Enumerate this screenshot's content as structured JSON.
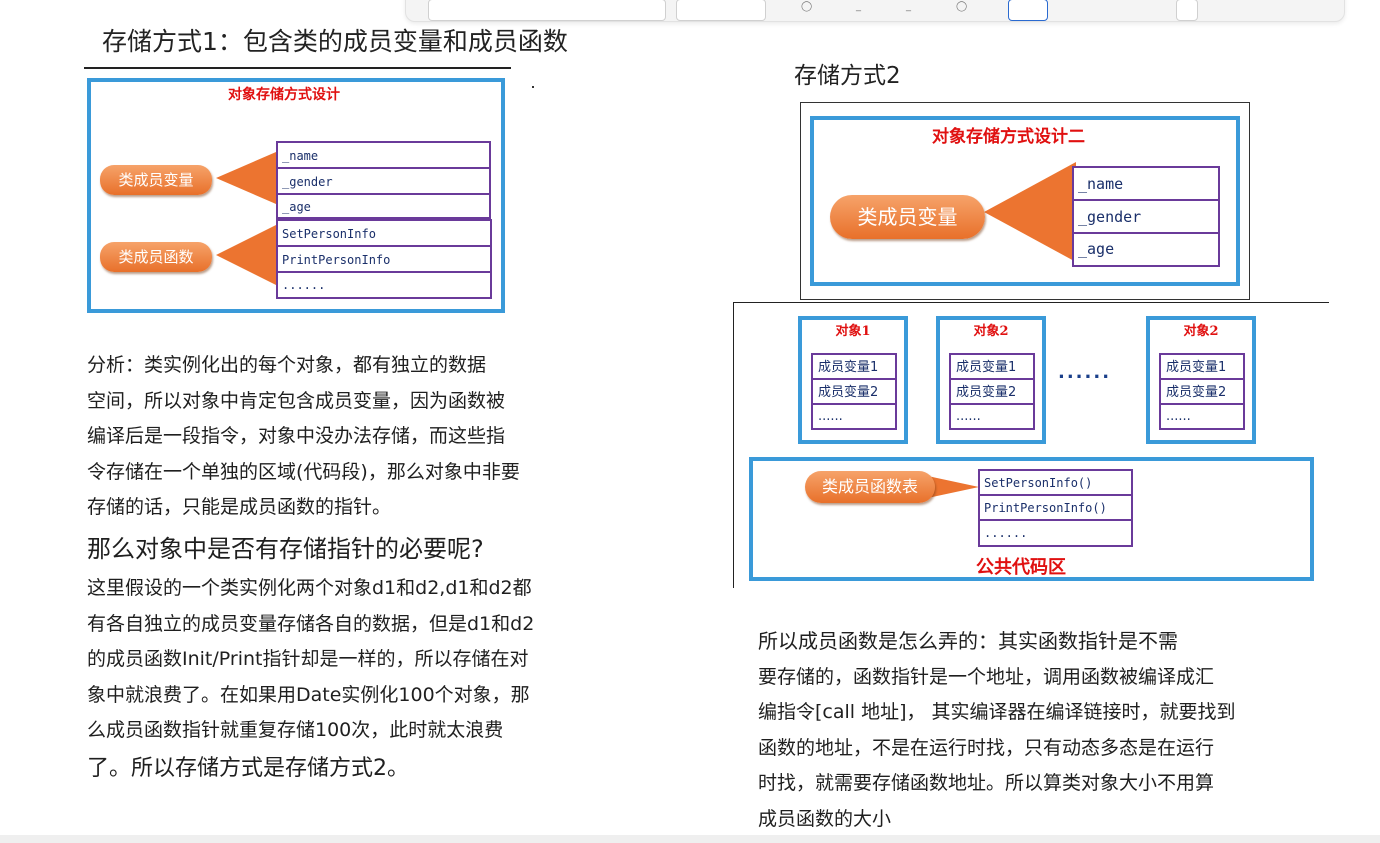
{
  "left": {
    "heading": "存储方式1：包含类的成员变量和成员函数",
    "diagram": {
      "title": "对象存储方式设计",
      "member_var_label": "类成员变量",
      "member_func_label": "类成员函数",
      "vars": [
        "_name",
        "_gender",
        "_age"
      ],
      "funcs": [
        "SetPersonInfo",
        "PrintPersonInfo",
        "......"
      ]
    },
    "analysis_lines": [
      "分析：类实例化出的每个对象，都有独立的数据",
      "空间，所以对象中肯定包含成员变量，因为函数被",
      "编译后是一段指令，对象中没办法存储，而这些指",
      "令存储在一个单独的区域(代码段)，那么对象中非要",
      "存储的话，只能是成员函数的指针。"
    ],
    "question": "那么对象中是否有存储指针的必要呢?",
    "answer_lines": [
      "这里假设的一个类实例化两个对象d1和d2,d1和d2都",
      "有各自独立的成员变量存储各自的数据，但是d1和d2",
      "的成员函数Init/Print指针却是一样的，所以存储在对",
      "象中就浪费了。在如果用Date实例化100个对象，那",
      "么成员函数指针就重复存储100次，此时就太浪费"
    ],
    "conclusion": "了。所以存储方式是存储方式2。"
  },
  "right": {
    "heading": "存储方式2",
    "diagram2": {
      "title": "对象存储方式设计二",
      "member_var_label": "类成员变量",
      "vars": [
        "_name",
        "_gender",
        "_age"
      ]
    },
    "objects": [
      {
        "title": "对象1",
        "cells": [
          "成员变量1",
          "成员变量2",
          "......"
        ]
      },
      {
        "title": "对象2",
        "cells": [
          "成员变量1",
          "成员变量2",
          "......"
        ]
      },
      {
        "title": "对象2",
        "cells": [
          "成员变量1",
          "成员变量2",
          "......"
        ]
      }
    ],
    "ellipsis": "......",
    "func_table_label": "类成员函数表",
    "funcs": [
      "SetPersonInfo()",
      "PrintPersonInfo()",
      "......"
    ],
    "public_code": "公共代码区",
    "explain_lines": [
      "所以成员函数是怎么弄的：其实函数指针是不需",
      "要存储的，函数指针是一个地址，调用函数被编译成汇",
      "编指令[call 地址]， 其实编译器在编译链接时，就要找到",
      "函数的地址，不是在运行时找，只有动态多态是在运行",
      "时找，就需要存储函数地址。所以算类对象大小不用算",
      "成员函数的大小"
    ]
  },
  "colors": {
    "frame_blue": "#3a9ad9",
    "title_red": "#e01010",
    "arrow_orange": "#ec7430",
    "cell_purple": "#6a3a9a"
  }
}
